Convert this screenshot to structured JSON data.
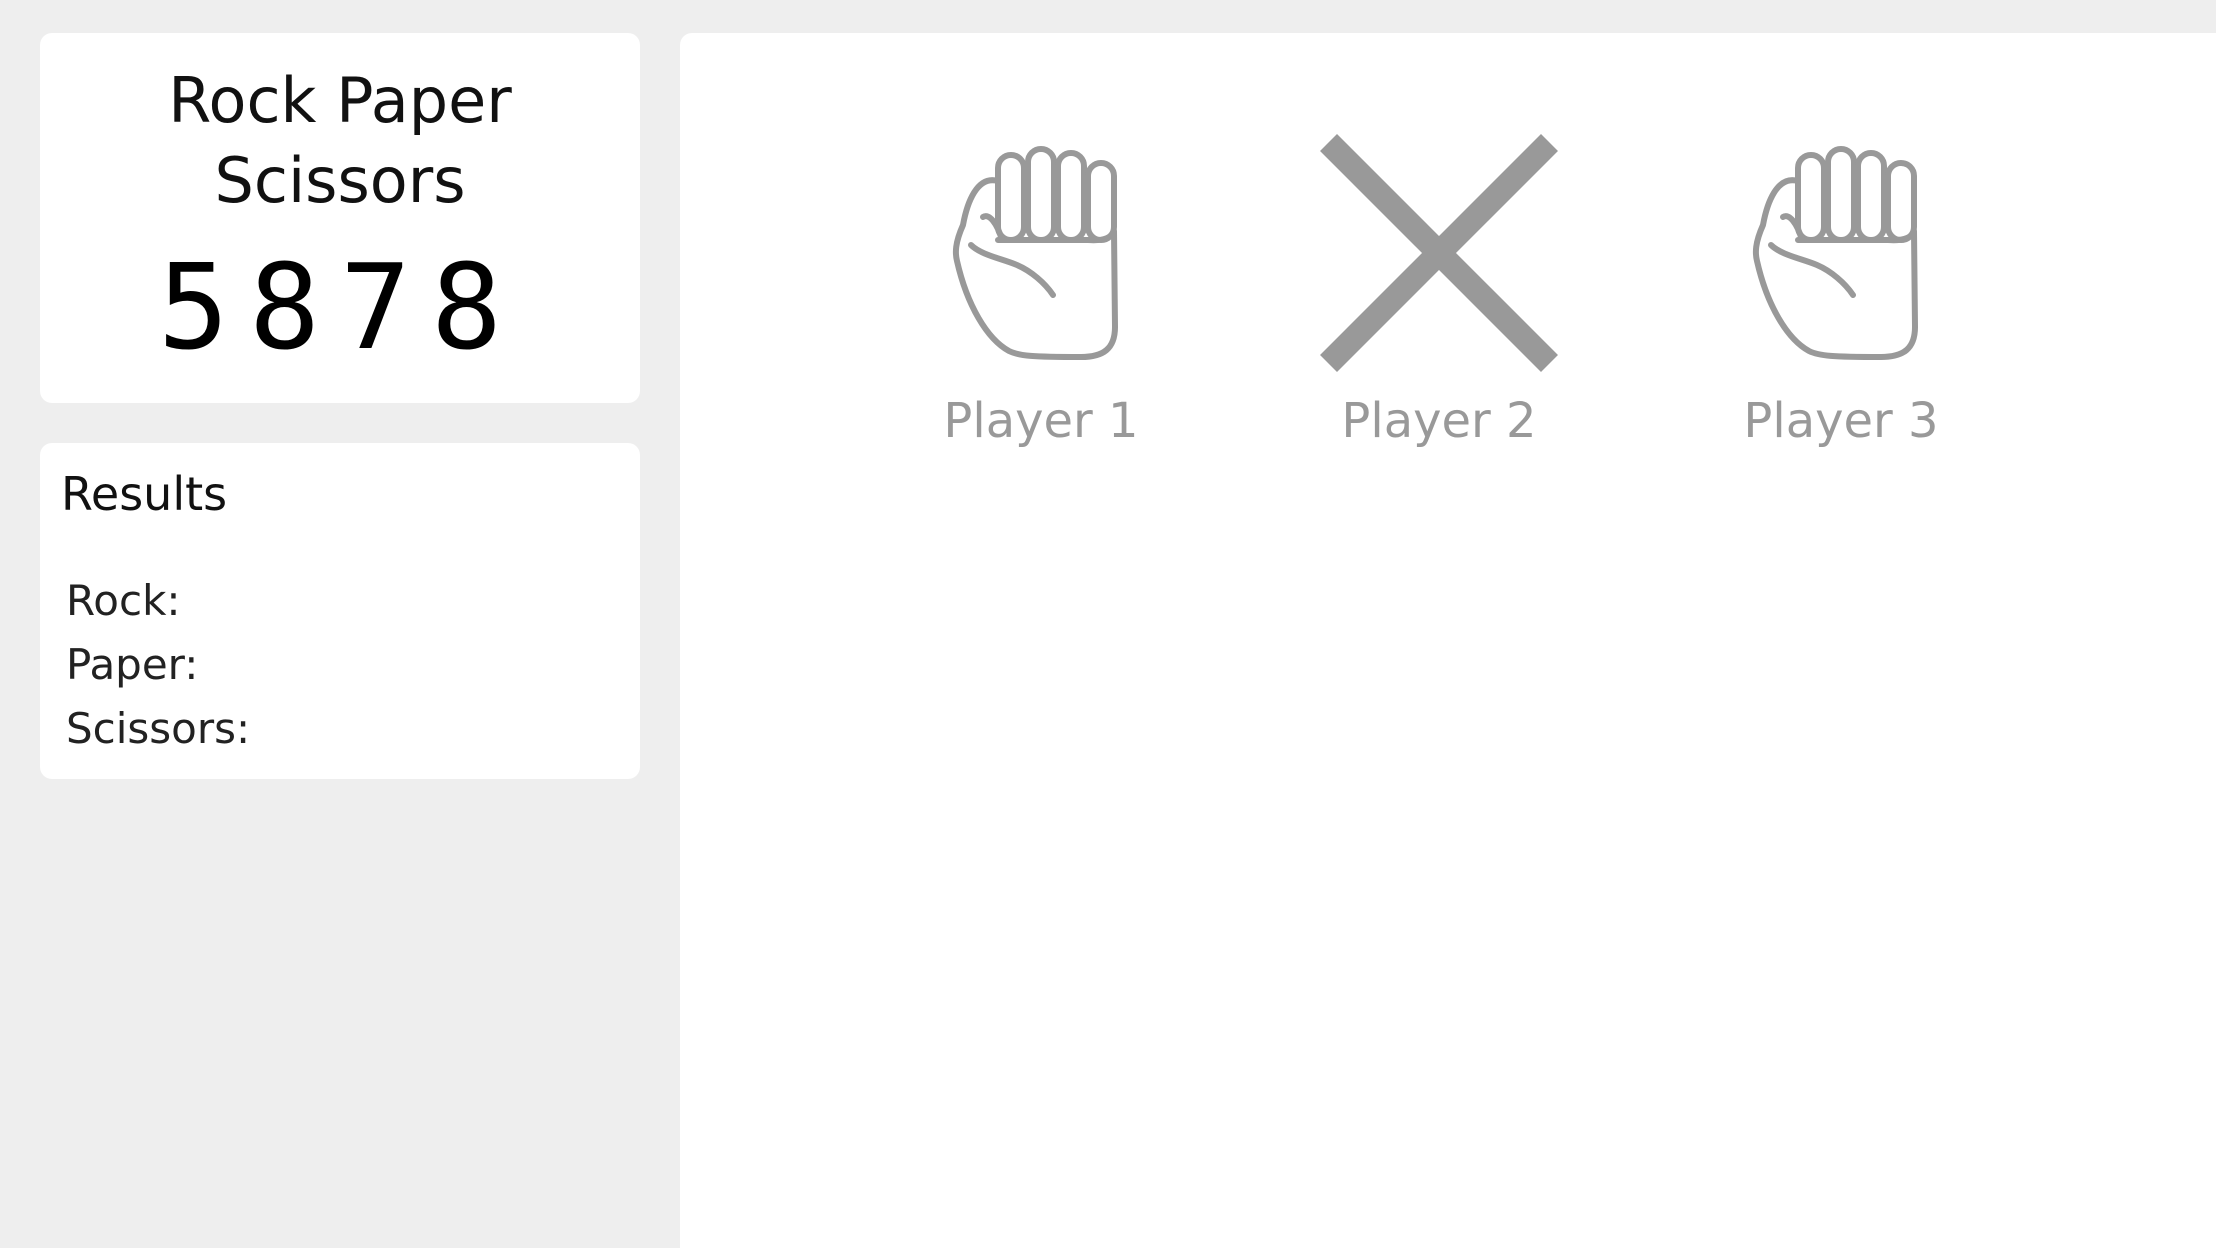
{
  "title": {
    "line1": "Rock Paper",
    "line2": "Scissors",
    "code": "5878"
  },
  "results": {
    "heading": "Results",
    "items": [
      {
        "label": "Rock:"
      },
      {
        "label": "Paper:"
      },
      {
        "label": "Scissors:"
      }
    ]
  },
  "players": [
    {
      "name": "Player 1",
      "icon": "rock-fist-icon"
    },
    {
      "name": "Player 2",
      "icon": "x-icon"
    },
    {
      "name": "Player 3",
      "icon": "rock-fist-icon"
    }
  ],
  "colors": {
    "background": "#eeeeee",
    "card": "#ffffff",
    "icon": "#999999",
    "player_label": "#999999",
    "text": "#111111"
  }
}
